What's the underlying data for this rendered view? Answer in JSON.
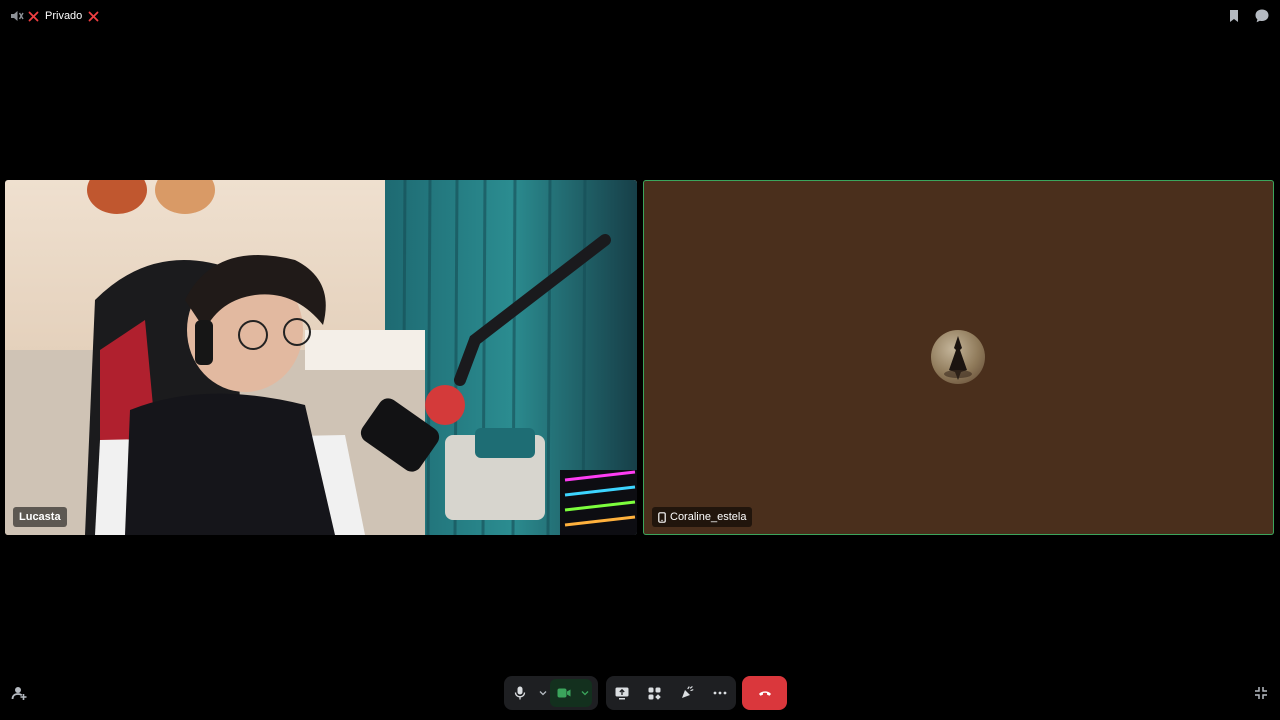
{
  "topbar": {
    "channel_name": "Privado",
    "icons": [
      "speaker-muted-icon",
      "x-icon",
      "x-icon",
      "bookmark-icon",
      "chat-icon"
    ]
  },
  "participants": [
    {
      "name": "Lucasta",
      "type": "video"
    },
    {
      "name": "Coraline_estela",
      "type": "avatar",
      "device": "mobile",
      "tile_color": "#4a2f1c",
      "speaking_border": "#3ba55c"
    }
  ],
  "controls": {
    "buttons": [
      "microphone-icon",
      "camera-icon",
      "screen-share-icon",
      "activities-icon",
      "soundboard-icon",
      "more-icon",
      "hang-up-icon"
    ],
    "camera_active_color": "#3ba55c",
    "hangup_color": "#da373c"
  },
  "corner": {
    "left": "invite-icon",
    "right": "exit-fullscreen-icon"
  }
}
